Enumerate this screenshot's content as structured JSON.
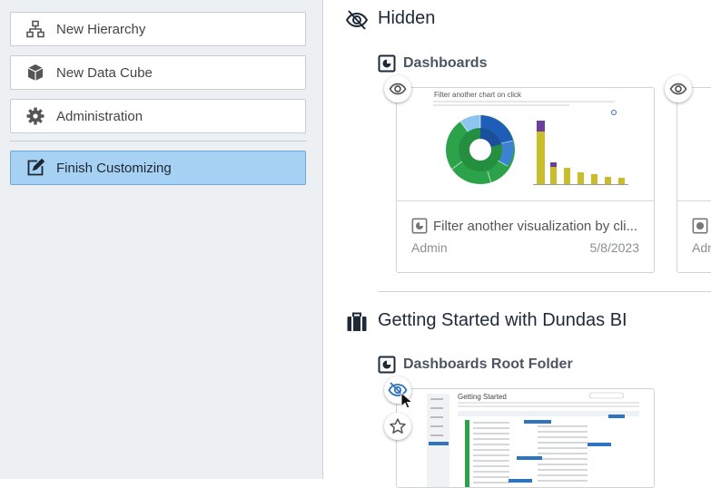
{
  "sidebar": {
    "items": [
      {
        "label": "New Hierarchy",
        "icon": "hierarchy-icon"
      },
      {
        "label": "New Data Cube",
        "icon": "cube-icon"
      },
      {
        "label": "Administration",
        "icon": "gear-icon"
      }
    ],
    "finish_label": "Finish Customizing"
  },
  "hidden_section": {
    "title": "Hidden",
    "folder_label": "Dashboards",
    "card": {
      "preview_title": "Filter another chart on click",
      "title": "Filter another visualization by cli...",
      "owner": "Admin",
      "date": "5/8/2023"
    },
    "partial_card_owner": "Adm"
  },
  "project_section": {
    "title": "Getting Started with Dundas BI",
    "folder_label": "Dashboards Root Folder",
    "card": {
      "preview_title": "Getting Started"
    }
  },
  "colors": {
    "accent": "#2f74c0",
    "primary_button": "#a7d1f3",
    "sunburst_green": "#2ca24a",
    "bar_yellow": "#c9bd2b"
  }
}
